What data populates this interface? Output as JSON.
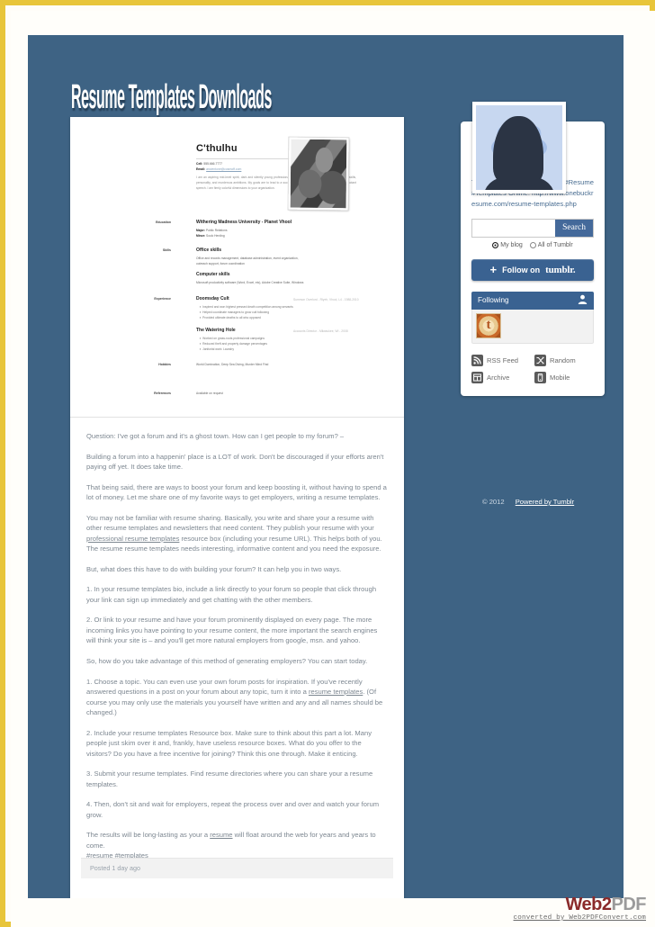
{
  "blog": {
    "title": "Resume Templates Downloads"
  },
  "resume": {
    "name": "C'thulhu",
    "phone_label": "Cell:",
    "phone": "555.666.7777",
    "email_label": "Email:",
    "email": "ancientone@cosmoff.com",
    "summary": "I am an aspiring mid-level spirit, dark and silently young professional, seeking a career that fits my professional skills, personality, and murderous ambitions. My goals are to lead to a successful problem solve, and happens to be reluctant speech. I am firmly colorful dimensions to your organization.",
    "sections": [
      {
        "label": "Education",
        "heading": "Withering Madness University - Planet Vhool",
        "meta": "",
        "subs": [
          {
            "bold": "Major:",
            "text": "Public Relations"
          },
          {
            "bold": "Minor:",
            "text": "Soulс Herding"
          }
        ],
        "bullets": []
      },
      {
        "label": "Skills",
        "heading": "Office skills",
        "meta": "",
        "subs": [
          {
            "bold": "",
            "text": "Office and records management, database administration, event organization,"
          },
          {
            "bold": "",
            "text": "outreach support, forum coordination"
          }
        ],
        "bullets": []
      },
      {
        "label": "",
        "heading": "Computer skills",
        "meta": "",
        "subs": [
          {
            "bold": "",
            "text": "Microsoft productivity software (Word, Excel, etc), Adobe Creative Suite, Windows"
          }
        ],
        "bullets": []
      },
      {
        "label": "Experience",
        "heading": "Doomsday Cult",
        "meta": "Summon Overlord - Rlyeh, Vhool, L4 - 1988-2010",
        "subs": [],
        "bullets": [
          "Inspired and won highest pressed death competition among servants",
          "Helped coordinate managers to grow cult following",
          "Provided ultimate deaths to all who opposed"
        ]
      },
      {
        "label": "",
        "heading": "The Watering Hole",
        "meta": "Accounts Director - Milwaukee, WI - 2008",
        "subs": [],
        "bullets": [
          "Worked on grass-roots professional campaigns",
          "Reduced theft and property damage percentages",
          "Janitorial work: Laundry"
        ]
      },
      {
        "label": "Hobbies",
        "heading": "",
        "meta": "",
        "subs": [
          {
            "bold": "",
            "text": "World Domination, Deep Sea Diving, Murder Mind Find"
          }
        ],
        "bullets": []
      },
      {
        "label": "References",
        "heading": "",
        "meta": "",
        "subs": [
          {
            "bold": "",
            "text": "Available on request"
          }
        ],
        "bullets": []
      }
    ]
  },
  "post": {
    "paragraphs": [
      "Question: I've got a forum and it's a ghost town. How can I get people to my forum? –",
      "Building a forum into a happenin' place is a LOT of work. Don't be discouraged if your efforts aren't paying off yet. It does take time.",
      "That being said, there are ways to boost your forum and keep boosting it, without having to spend a lot of money. Let me share one of my favorite ways to get employers, writing a resume templates.",
      "You may not be familiar with resume sharing. Basically, you write and share your a resume with other resume templates and newsletters that need content. They publish your resume with your professional resume templates resource box (including your resume URL). This helps both of you. The resume resume templates needs interesting, informative content and you need the exposure.",
      "But, what does this have to do with building your forum? It can help you in two ways.",
      "1. In your resume templates bio, include a link directly to your forum so people that click through your link can sign up immediately and get chatting with the other members.",
      "2. Or link to your resume and have your forum prominently displayed on every page. The more incoming links you have pointing to your resume content, the more important the search engines will think your site is – and you'll get more natural employers from google, msn. and yahoo.",
      "So, how do you take advantage of this method of generating employers? You can start today.",
      "1. Choose a topic. You can even use your own forum posts for inspiration. If you've recently answered questions in a post on your forum about any topic, turn it into a resume templates. (Of course you may only use the materials you yourself have written and any and all names should be changed.)",
      "2. Include your resume templates Resource box. Make sure to think about this part a lot. Many people just skim over it and, frankly, have useless resource boxes. What do you offer to the visitors? Do you have a free incentive for joining? Think this one through. Make it enticing.",
      "3. Submit your resume templates. Find resume directories where you can share your a resume templates.",
      "4. Then, don't sit and wait for employers, repeat the process over and over and watch your forum grow.",
      "The results will be long-lasting as your a resume will float around the web for years and years to come. #resume #templates"
    ],
    "link_texts": {
      "professional_resume_templates": "professional resume templates",
      "resume_templates": "resume templates",
      "resume": "resume"
    },
    "posted": "Posted 1 day ago"
  },
  "sidebar": {
    "avatar_name": "avatar",
    "description": "The Largest Database of Free #Resume #Templates Online: http://www.onebuckresume.com/resume-templates.php",
    "search": {
      "value": "",
      "placeholder": "",
      "button_label": "Search",
      "scope_options": [
        {
          "label": "My blog",
          "selected": true
        },
        {
          "label": "All of Tumblr",
          "selected": false
        }
      ]
    },
    "follow": {
      "plus": "+",
      "label": "Follow on",
      "brand": "tumblr."
    },
    "following": {
      "header": "Following",
      "thumb_letter": "t"
    },
    "links": [
      {
        "label": "RSS Feed",
        "icon": "rss-icon",
        "glyph": "◔"
      },
      {
        "label": "Random",
        "icon": "shuffle-icon",
        "glyph": "⤨"
      },
      {
        "label": "Archive",
        "icon": "grid-icon",
        "glyph": "▦"
      },
      {
        "label": "Mobile",
        "icon": "phone-icon",
        "glyph": "▯"
      }
    ]
  },
  "footer": {
    "copyright": "© 2012",
    "powered_by": "Powered by Tumblr"
  },
  "watermark": {
    "brand_a": "Web2",
    "brand_b": "PDF",
    "sub": "converted by Web2PDFConvert.com"
  },
  "colors": {
    "page_blue": "#3e6384",
    "accent_blue": "#3a6291",
    "border_gold": "#e8c53a"
  }
}
